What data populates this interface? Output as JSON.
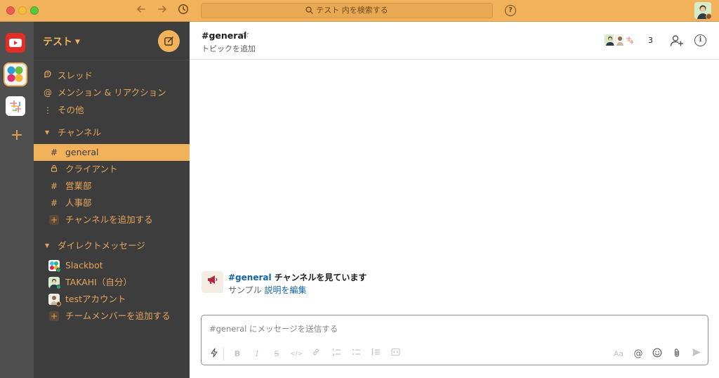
{
  "titlebar": {
    "search_placeholder": "テスト 内を検索する",
    "help_label": "?"
  },
  "workspace_rail": {
    "add_label": "+"
  },
  "sidebar": {
    "team_name": "テスト",
    "nav": [
      {
        "label": "スレッド",
        "icon": "threads-icon"
      },
      {
        "label": "メンション & リアクション",
        "icon": "at-icon"
      },
      {
        "label": "その他",
        "icon": "more-vertical-icon"
      }
    ],
    "channels_section": "チャンネル",
    "channels": [
      {
        "label": "general",
        "prefix": "#",
        "active": true
      },
      {
        "label": "クライアント",
        "prefix": "lock",
        "active": false
      },
      {
        "label": "営業部",
        "prefix": "#",
        "active": false
      },
      {
        "label": "人事部",
        "prefix": "#",
        "active": false
      }
    ],
    "add_channel": "チャンネルを追加する",
    "dm_section": "ダイレクトメッセージ",
    "dms": [
      {
        "label": "Slackbot"
      },
      {
        "label": "TAKAHI（自分）"
      },
      {
        "label": "testアカウント"
      }
    ],
    "add_member": "チームメンバーを追加する"
  },
  "channel_header": {
    "title": "#general",
    "topic": "トピックを追加",
    "member_count": "3"
  },
  "intro": {
    "channel_link": "#general",
    "title_rest": " チャンネルを見ています",
    "description": "サンプル ",
    "edit_link": "説明を編集"
  },
  "composer": {
    "placeholder": "#general にメッセージを送信する",
    "aa_label": "Aa",
    "at_label": "@"
  },
  "colors": {
    "titlebar": "#f2b15b",
    "sidebar": "#3d3d3d",
    "rail": "#4f4f4f",
    "accent": "#e5a65a",
    "active_channel": "#f2b15b",
    "link": "#1264a3"
  }
}
